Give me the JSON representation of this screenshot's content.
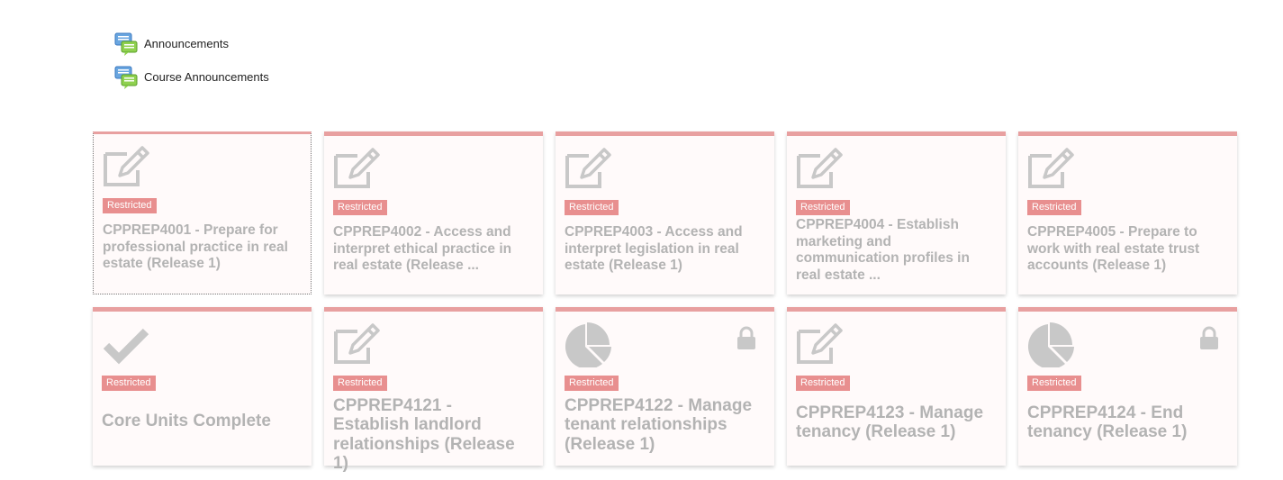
{
  "announcements": [
    {
      "label": "Announcements",
      "icon": "forum-icon"
    },
    {
      "label": "Course Announcements",
      "icon": "forum-icon"
    }
  ],
  "tiles": [
    {
      "badge": "Restricted",
      "title": "CPPREP4001 - Prepare for professional practice in real estate (Release 1)",
      "icon": "edit-icon",
      "locked": false
    },
    {
      "badge": "Restricted",
      "title": "CPPREP4002 - Access and interpret ethical practice in real estate (Release ...",
      "icon": "edit-icon",
      "locked": false
    },
    {
      "badge": "Restricted",
      "title": "CPPREP4003 - Access and interpret legislation in real estate (Release 1)",
      "icon": "edit-icon",
      "locked": false
    },
    {
      "badge": "Restricted",
      "title": "CPPREP4004 - Establish marketing and communication profiles in real estate ...",
      "icon": "edit-icon",
      "locked": false
    },
    {
      "badge": "Restricted",
      "title": "CPPREP4005 - Prepare to work with real estate trust accounts (Release 1)",
      "icon": "edit-icon",
      "locked": false
    },
    {
      "badge": "Restricted",
      "title": "Core Units Complete",
      "icon": "checkmark-icon",
      "locked": false
    },
    {
      "badge": "Restricted",
      "title": "CPPREP4121 - Establish landlord relationships (Release 1)",
      "icon": "edit-icon",
      "locked": false
    },
    {
      "badge": "Restricted",
      "title": "CPPREP4122 - Manage tenant relationships (Release 1)",
      "icon": "pie-chart-icon",
      "locked": true
    },
    {
      "badge": "Restricted",
      "title": "CPPREP4123 - Manage tenancy (Release 1)",
      "icon": "edit-icon",
      "locked": false
    },
    {
      "badge": "Restricted",
      "title": "CPPREP4124 - End tenancy (Release 1)",
      "icon": "pie-chart-icon",
      "locked": true
    }
  ],
  "colors": {
    "accent": "#e8a0a0",
    "badge": "#e88f8f",
    "tile_background": "#fffafa",
    "text_muted": "#b3b3b3",
    "icon_gray": "#c8c8c8"
  }
}
